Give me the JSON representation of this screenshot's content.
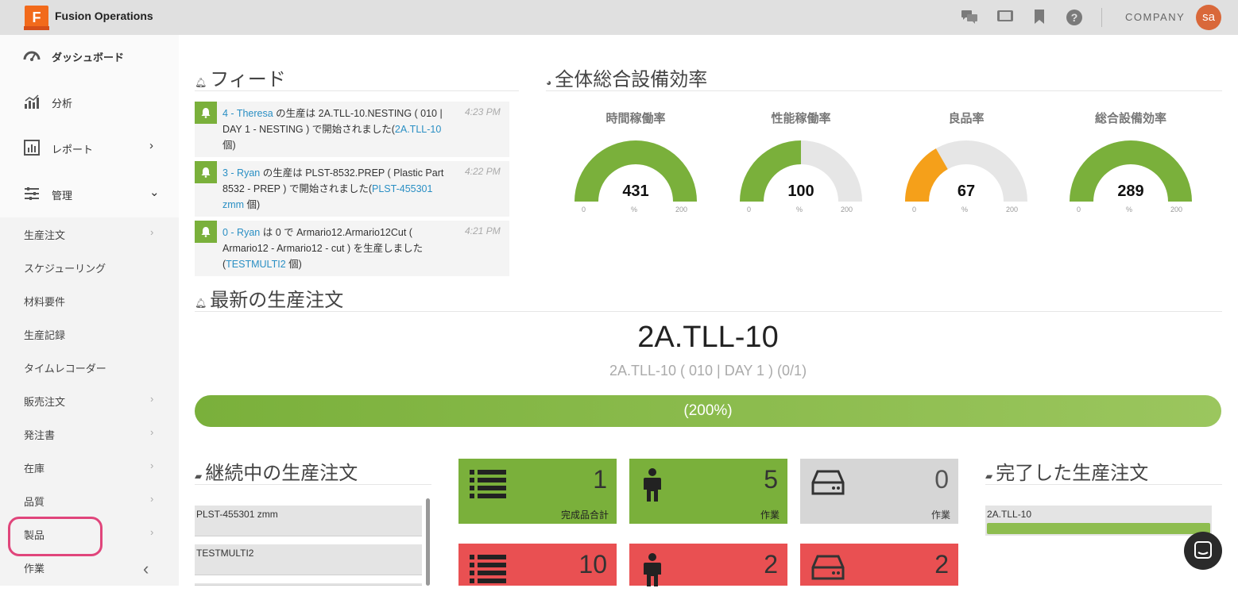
{
  "app": {
    "title": "Fusion Operations",
    "logo_letter": "F",
    "company": "COMPANY",
    "avatar": "sa"
  },
  "topbar_icons": [
    "chat-icon",
    "tablet-icon",
    "bookmark-icon",
    "help-icon"
  ],
  "sidebar": {
    "main": [
      {
        "label": "ダッシュボード",
        "icon": "dashboard-icon"
      },
      {
        "label": "分析",
        "icon": "analytics-icon"
      },
      {
        "label": "レポート",
        "icon": "report-icon",
        "chevron": "›"
      },
      {
        "label": "管理",
        "icon": "settings-sliders-icon",
        "chevron": "⌄"
      }
    ],
    "sub": [
      {
        "label": "生産注文",
        "chevron": "›"
      },
      {
        "label": "スケジューリング",
        "chevron": ""
      },
      {
        "label": "材料要件",
        "chevron": ""
      },
      {
        "label": "生産記録",
        "chevron": ""
      },
      {
        "label": "タイムレコーダー",
        "chevron": ""
      },
      {
        "label": "販売注文",
        "chevron": "›"
      },
      {
        "label": "発注書",
        "chevron": "›"
      },
      {
        "label": "在庫",
        "chevron": "›"
      },
      {
        "label": "品質",
        "chevron": "›"
      },
      {
        "label": "製品",
        "chevron": "›"
      },
      {
        "label": "作業",
        "chevron": ""
      }
    ],
    "collapse": "‹"
  },
  "feed": {
    "title": "フィード",
    "items": [
      {
        "user": "4 - Theresa",
        "text1": " の生産は 2A.TLL-10.NESTING ( 010 | DAY 1 - NESTING ) で開始されました(",
        "link": "2A.TLL-10",
        "text2": " 個)",
        "time": "4:23 PM"
      },
      {
        "user": "3 - Ryan",
        "text1": " の生産は PLST-8532.PREP ( Plastic Part 8532 - PREP ) で開始されました(",
        "link": "PLST-455301 zmm",
        "text2": " 個)",
        "time": "4:22 PM"
      },
      {
        "user": "0 - Ryan",
        "text1": " は 0 で Armario12.Armario12Cut ( Armario12 - Armario12 - cut ) を生産しました (",
        "link": "TESTMULTI2",
        "text2": " 個)",
        "time": "4:21 PM"
      }
    ]
  },
  "oee": {
    "title": "全体総合設備効率",
    "gauges": [
      {
        "label": "時間稼働率",
        "value": 431,
        "fraction": 1.0,
        "color": "#7ab03b",
        "min": "0",
        "unit": "%",
        "max": "200"
      },
      {
        "label": "性能稼働率",
        "value": 100,
        "fraction": 0.5,
        "color": "#7ab03b",
        "min": "0",
        "unit": "%",
        "max": "200"
      },
      {
        "label": "良品率",
        "value": 67,
        "fraction": 0.335,
        "color": "#f5a01a",
        "min": "0",
        "unit": "%",
        "max": "200"
      },
      {
        "label": "総合設備効率",
        "value": 289,
        "fraction": 1.0,
        "color": "#7ab03b",
        "min": "0",
        "unit": "%",
        "max": "200"
      }
    ]
  },
  "latest": {
    "title": "最新の生産注文",
    "order": "2A.TLL-10",
    "detail": "2A.TLL-10 ( 010 | DAY 1 ) (0/1)",
    "progress_label": "(200%)",
    "progress_fraction": 1.0
  },
  "ongoing": {
    "title": "継続中の生産注文",
    "items": [
      "PLST-455301 zmm",
      "TESTMULTI2"
    ]
  },
  "tiles": [
    {
      "num": "1",
      "label": "完成品合計",
      "color": "green",
      "icon": "list-icon"
    },
    {
      "num": "5",
      "label": "作業",
      "color": "green",
      "icon": "person-icon"
    },
    {
      "num": "0",
      "label": "作業",
      "color": "gray",
      "icon": "drive-icon"
    },
    {
      "num": "10",
      "label": "",
      "color": "red",
      "icon": "list-icon"
    },
    {
      "num": "2",
      "label": "",
      "color": "red",
      "icon": "person-icon"
    },
    {
      "num": "2",
      "label": "",
      "color": "red",
      "icon": "drive-icon"
    }
  ],
  "completed": {
    "title": "完了した生産注文",
    "items": [
      "2A.TLL-10"
    ]
  }
}
